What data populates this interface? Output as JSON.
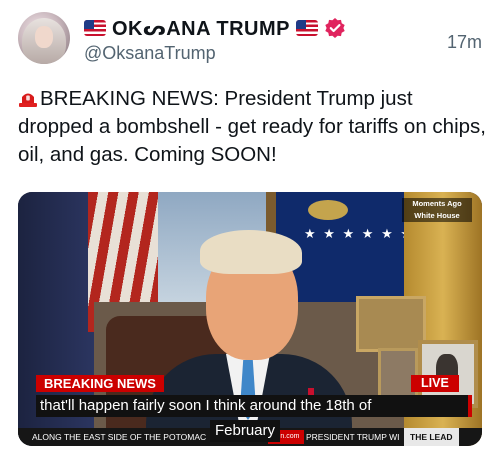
{
  "author": {
    "display_name": "OKᔕANA TRUMP",
    "handle": "@OksanaTrump",
    "verified": true,
    "avatar": "avatar-photo",
    "flag_icon": "us-flag-icon"
  },
  "tweet": {
    "timestamp": "17m",
    "text": "BREAKING NEWS: President Trump just dropped a bombshell - get ready for tariffs on chips, oil, and gas. Coming SOON!",
    "text_icon": "rotating-light-icon"
  },
  "media": {
    "corner_line1": "Moments Ago",
    "corner_line2": "White House",
    "breaking_label": "BREAKING NEWS",
    "live_label": "LIVE",
    "caption_line1": "that'll happen fairly soon I think around the 18th of",
    "caption_line2": "February",
    "ticker_left": "ALONG THE EAST SIDE OF THE POTOMAC",
    "ticker_logo": "cnn.com",
    "ticker_middle": "PRESIDENT TRUMP WI",
    "ticker_show": "THE LEAD"
  },
  "colors": {
    "text": "#0f1419",
    "secondary_text": "#536471",
    "verified_badge": "#e0245e",
    "breaking_red": "#cc0000"
  }
}
